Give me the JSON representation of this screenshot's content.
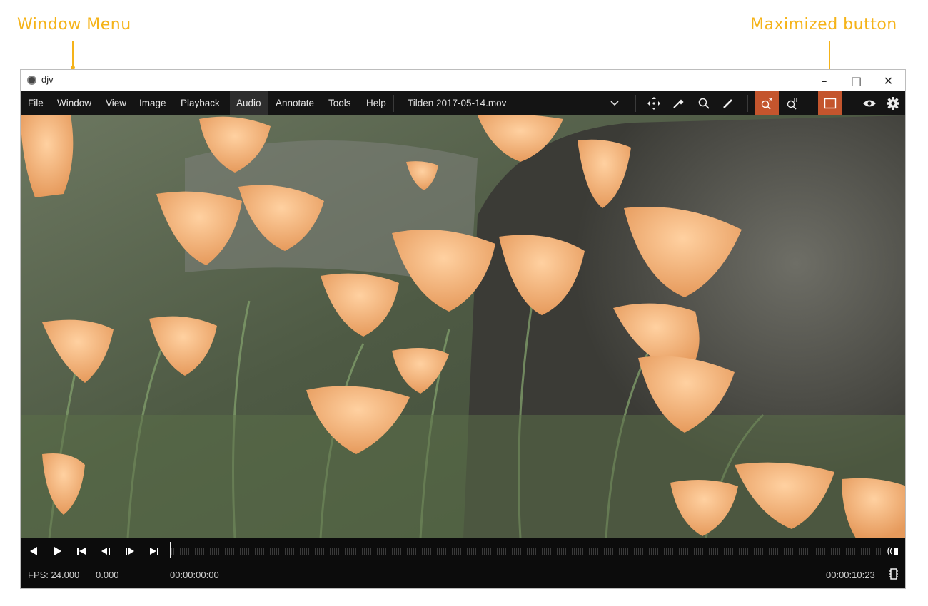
{
  "callouts": {
    "window_menu": "Window Menu",
    "maximized_button": "Maximized button"
  },
  "app": {
    "title": "djv"
  },
  "window_controls": {
    "minimize": "–",
    "maximize": "□",
    "close": "✕"
  },
  "menu": {
    "items": [
      {
        "label": "File"
      },
      {
        "label": "Window"
      },
      {
        "label": "View"
      },
      {
        "label": "Image"
      },
      {
        "label": "Playback"
      },
      {
        "label": "Audio"
      },
      {
        "label": "Annotate"
      },
      {
        "label": "Tools"
      },
      {
        "label": "Help"
      }
    ],
    "active": "Audio"
  },
  "file": {
    "name": "Tilden 2017-05-14.mov"
  },
  "toolbar": {
    "icons": [
      "chevron-down-icon",
      "pan-icon",
      "color-picker-icon",
      "magnify-icon",
      "annotate-pen-icon",
      "zoom-fit-icon",
      "zoom-actual-icon",
      "maximize-view-icon",
      "eye-icon",
      "gear-icon"
    ],
    "active": [
      "zoom-fit-icon",
      "maximize-view-icon"
    ],
    "accent_color": "#c4552d"
  },
  "playback": {
    "icons": [
      "play-reverse-icon",
      "play-forward-icon",
      "skip-start-icon",
      "step-back-icon",
      "step-forward-icon",
      "skip-end-icon",
      "audio-icon",
      "layout-icon"
    ],
    "fps": "FPS: 24.000",
    "realtime": "0.000",
    "current_time": "00:00:00:00",
    "end_time": "00:00:10:23"
  },
  "colors": {
    "callout": "#f5b319",
    "menubar": "#141414",
    "controls": "#0c0c0c"
  }
}
